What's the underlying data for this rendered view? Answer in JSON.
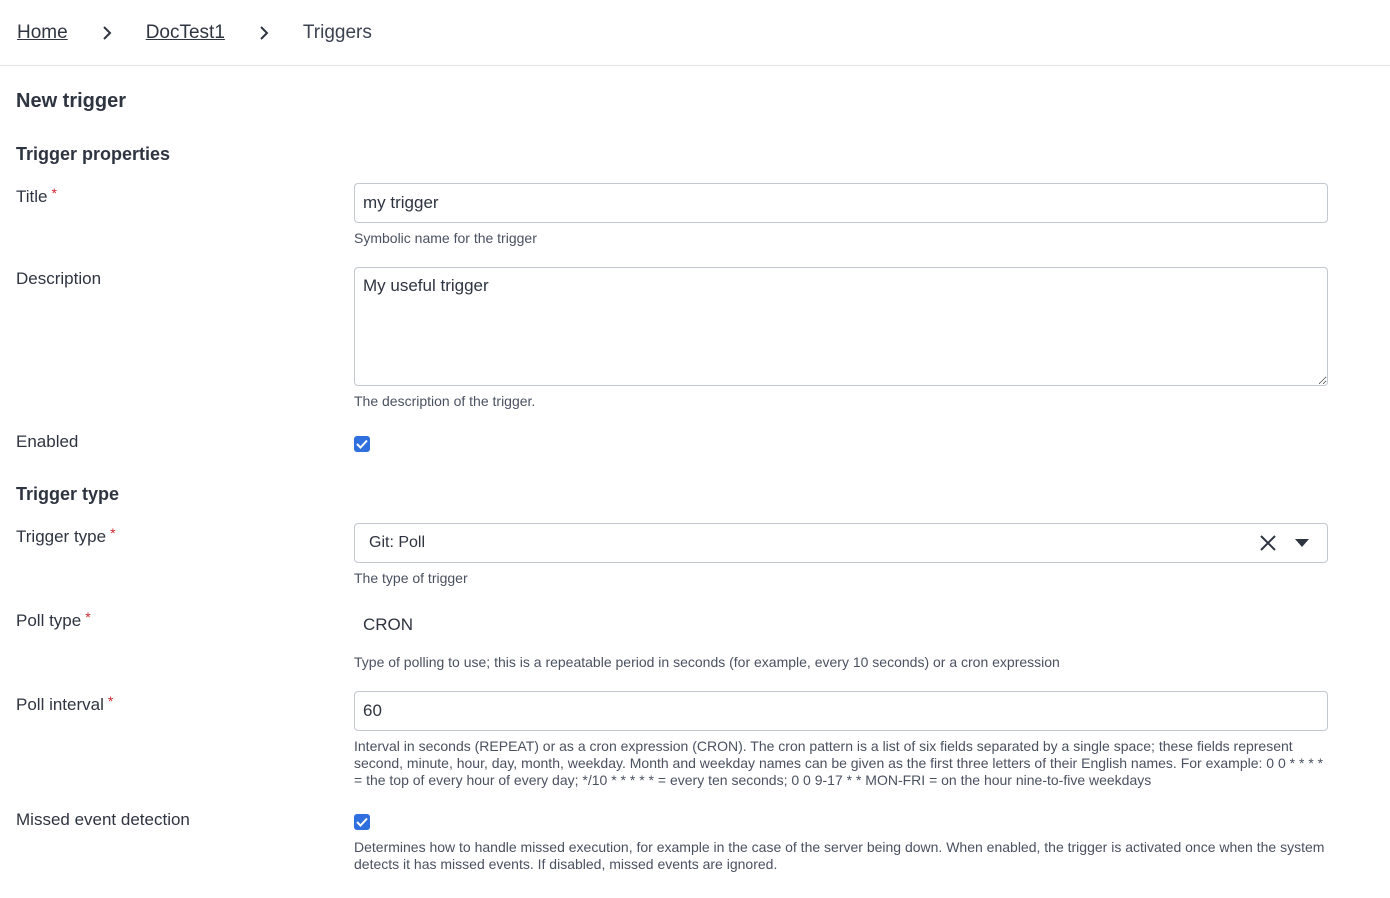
{
  "breadcrumb": {
    "items": [
      {
        "label": "Home"
      },
      {
        "label": "DocTest1"
      },
      {
        "label": "Triggers"
      }
    ]
  },
  "page": {
    "title": "New trigger"
  },
  "sections": {
    "properties": "Trigger properties",
    "type": "Trigger type"
  },
  "fields": {
    "title": {
      "label": "Title",
      "required": "*",
      "value": "my trigger",
      "help": "Symbolic name for the trigger"
    },
    "description": {
      "label": "Description",
      "value": "My useful trigger",
      "help": "The description of the trigger."
    },
    "enabled": {
      "label": "Enabled",
      "checked": true
    },
    "trigger_type": {
      "label": "Trigger type",
      "required": "*",
      "value": "Git: Poll",
      "help": "The type of trigger"
    },
    "poll_type": {
      "label": "Poll type",
      "required": "*",
      "value": "CRON",
      "help": "Type of polling to use; this is a repeatable period in seconds (for example, every 10 seconds) or a cron expression"
    },
    "poll_interval": {
      "label": "Poll interval",
      "required": "*",
      "value": "60",
      "help": "Interval in seconds (REPEAT) or as a cron expression (CRON). The cron pattern is a list of six fields separated by a single space; these fields represent second, minute, hour, day, month, weekday. Month and weekday names can be given as the first three letters of their English names. For example: 0 0 * * * * = the top of every hour of every day; */10 * * * * * = every ten seconds; 0 0 9-17 * * MON-FRI = on the hour nine-to-five weekdays"
    },
    "missed_event": {
      "label": "Missed event detection",
      "checked": true,
      "help": "Determines how to handle missed execution, for example in the case of the server being down. When enabled, the trigger is activated once when the system detects it has missed events. If disabled, missed events are ignored."
    }
  },
  "icons": {
    "breadcrumb_separator": "chevron-right-icon",
    "checkbox": "check-icon",
    "select_clear": "close-icon",
    "select_open": "caret-down-icon"
  },
  "colors": {
    "accent": "#2f6fde",
    "required": "#d0262d"
  }
}
